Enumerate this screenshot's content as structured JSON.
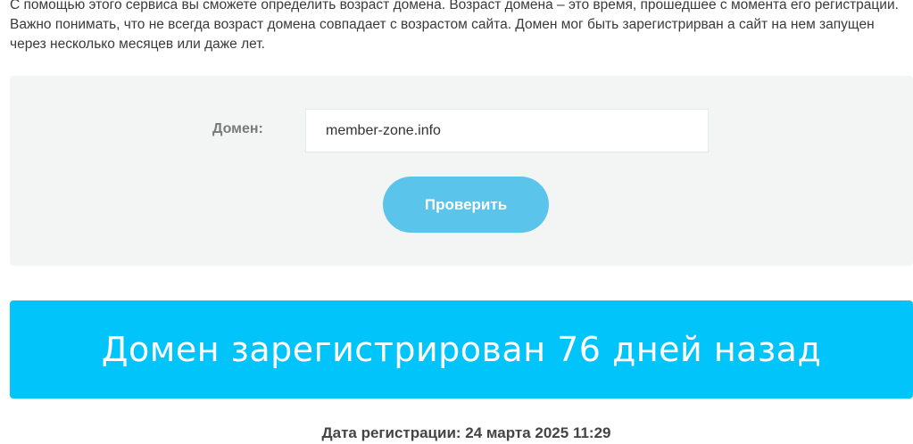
{
  "intro": {
    "text": "С помощью этого сервиса вы сможете определить возраст домена. Возраст домена – это время, прошедшее с момента его регистрации. Важно понимать, что не всегда возраст домена совпадает с возрастом сайта. Домен мог быть зарегистрирван а сайт на нем запущен через несколько месяцев или даже лет."
  },
  "form": {
    "domain_label": "Домен:",
    "domain_value": "member-zone.info",
    "check_button_label": "Проверить"
  },
  "result": {
    "message": "Домен зарегистрирован 76 дней назад",
    "registration_date": "Дата регистрации: 24 марта 2025 11:29"
  },
  "colors": {
    "panel_bg": "#f3f5f5",
    "button_bg": "#5bc4ea",
    "banner_bg": "#00c4fa"
  }
}
